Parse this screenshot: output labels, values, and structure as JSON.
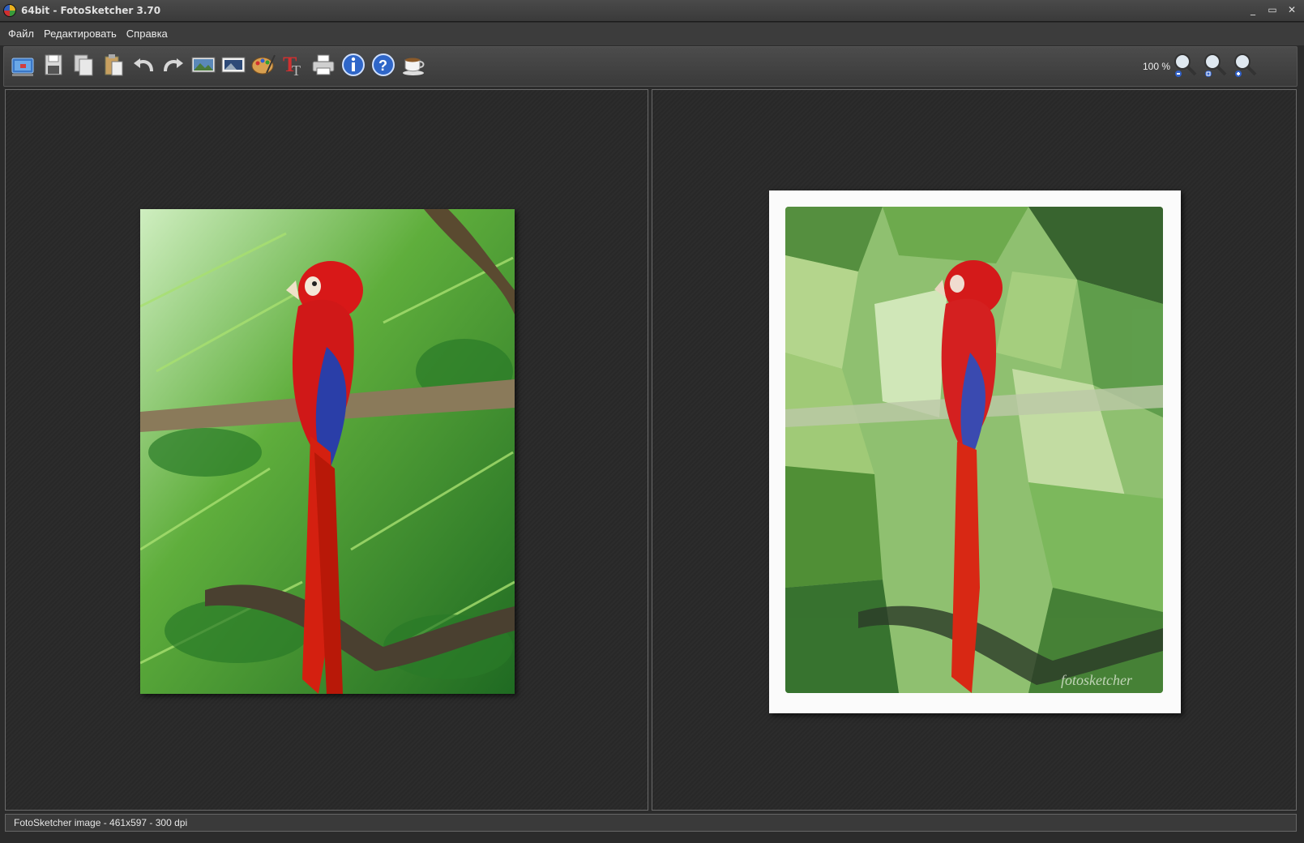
{
  "window": {
    "title": "64bit - FotoSketcher 3.70",
    "controls": {
      "minimize": "_",
      "maximize": "▭",
      "close": "✕"
    }
  },
  "menu": {
    "items": [
      "Файл",
      "Редактировать",
      "Справка"
    ]
  },
  "toolbar": {
    "tools": [
      "open-image-icon",
      "save-icon",
      "copy-icon",
      "paste-icon",
      "undo-icon",
      "redo-icon",
      "image-settings-icon",
      "picture-frame-icon",
      "palette-icon",
      "text-tool-icon",
      "print-icon",
      "info-icon",
      "help-icon",
      "coffee-cup-icon"
    ],
    "zoom": "100 %",
    "zoom_tools": [
      "zoom-out-icon",
      "zoom-fit-icon",
      "zoom-in-icon"
    ]
  },
  "panels": {
    "left": {
      "content": "original parrot photo"
    },
    "right": {
      "content": "painted parrot sketch",
      "watermark": "fotosketcher"
    }
  },
  "status": {
    "text": "FotoSketcher image - 461x597 - 300 dpi"
  },
  "colors": {
    "window_bg": "#2b2b2b",
    "panel_border": "#6a6a6a",
    "toolbar_bg": "#444444"
  }
}
